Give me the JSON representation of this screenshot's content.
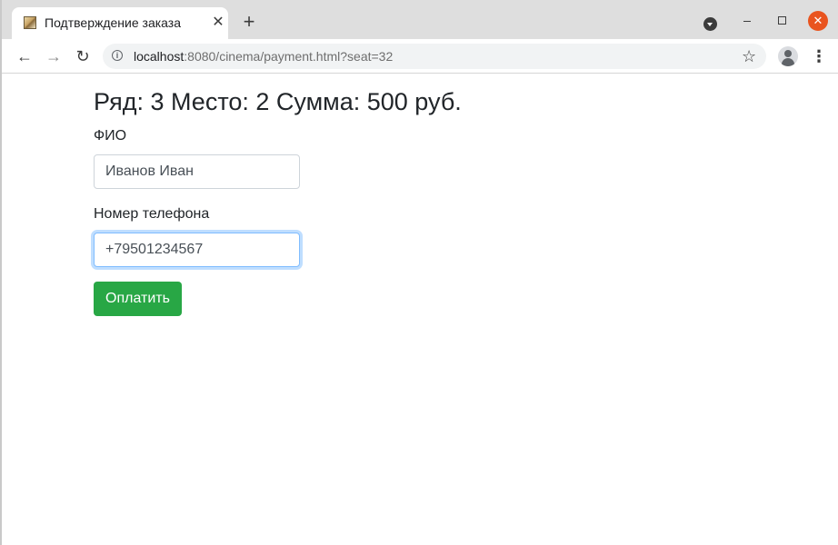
{
  "browser": {
    "tab": {
      "title": "Подтверждение заказа",
      "close_glyph": "✕",
      "favicon": "cinema-favicon"
    },
    "new_tab_glyph": "+",
    "window_controls": {
      "close_glyph": "✕"
    },
    "address_bar": {
      "host": "localhost",
      "path": ":8080/cinema/payment.html?seat=32"
    },
    "icons": {
      "back": "back-arrow-icon",
      "forward": "forward-arrow-icon",
      "reload": "reload-icon",
      "info": "info-icon",
      "bookmark": "star-icon",
      "profile": "profile-icon",
      "menu": "kebab-menu-icon"
    },
    "glyphs": {
      "back": "←",
      "forward": "→",
      "reload": "↻",
      "info": "i",
      "star": "☆",
      "menu": "⋮"
    }
  },
  "order": {
    "summary": "Ряд: 3 Место: 2 Сумма: 500 руб."
  },
  "form": {
    "name_label": "ФИО",
    "name_value": "Иванов Иван",
    "phone_label": "Номер телефона",
    "phone_value": "+79501234567",
    "submit_label": "Оплатить"
  },
  "colors": {
    "submit_button": "#28a745",
    "focus_ring": "#80bdff",
    "window_close": "#e9541f"
  }
}
